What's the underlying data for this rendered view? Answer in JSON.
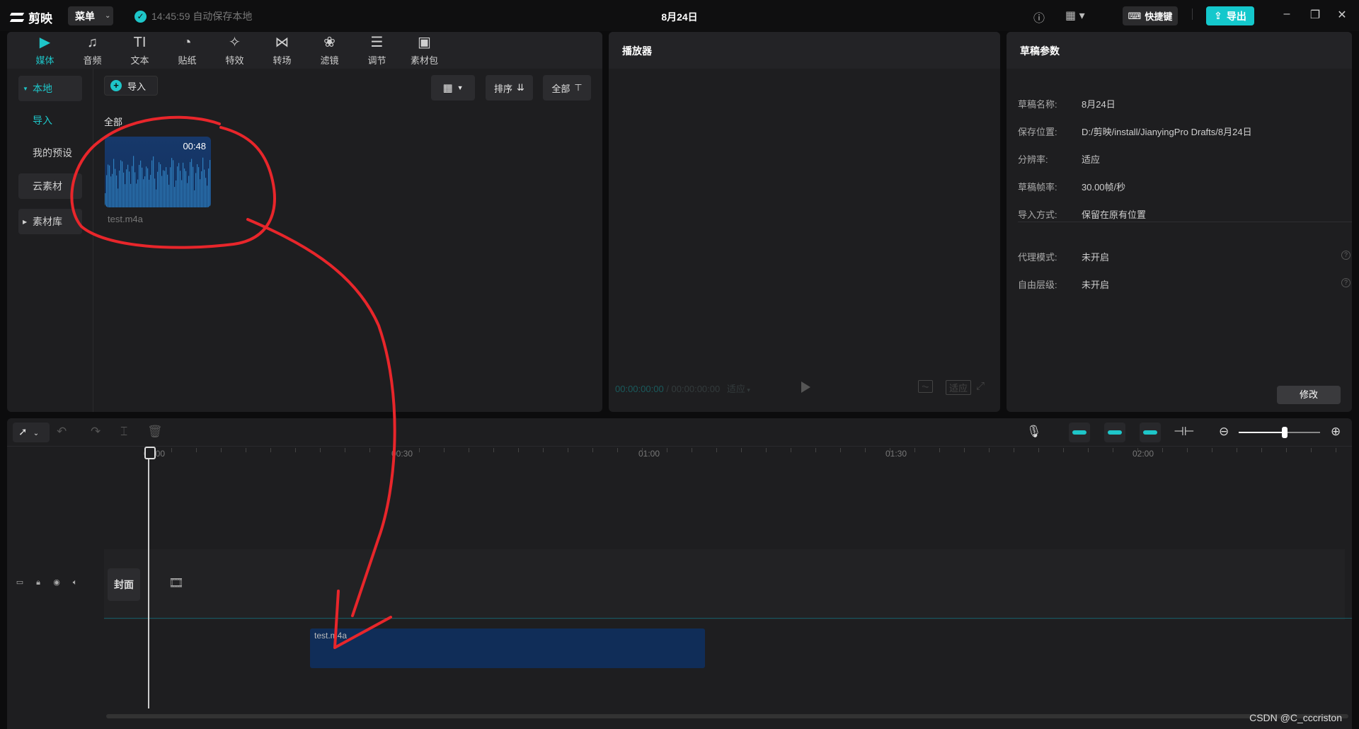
{
  "titlebar": {
    "app_name": "剪映",
    "menu_label": "菜单",
    "autosave_text": "14:45:59 自动保存本地",
    "project_title": "8月24日",
    "shortcut_label": "快捷键",
    "export_label": "导出"
  },
  "media": {
    "tools": [
      {
        "label": "媒体",
        "icon": "media-icon",
        "glyph": "▶"
      },
      {
        "label": "音频",
        "icon": "audio-icon",
        "glyph": "♫"
      },
      {
        "label": "文本",
        "icon": "text-icon",
        "glyph": "TI"
      },
      {
        "label": "贴纸",
        "icon": "sticker-icon",
        "glyph": "◔"
      },
      {
        "label": "特效",
        "icon": "effects-icon",
        "glyph": "✧"
      },
      {
        "label": "转场",
        "icon": "transition-icon",
        "glyph": "⋈"
      },
      {
        "label": "滤镜",
        "icon": "filter-icon",
        "glyph": "❀"
      },
      {
        "label": "调节",
        "icon": "adjust-icon",
        "glyph": "☰"
      },
      {
        "label": "素材包",
        "icon": "package-icon",
        "glyph": "▣"
      }
    ],
    "side": {
      "local": "本地",
      "import": "导入",
      "presets": "我的预设",
      "cloud": "云素材",
      "library": "素材库"
    },
    "import_label": "导入",
    "sort_label": "排序",
    "filter_label": "全部",
    "all_label": "全部",
    "clip_duration": "00:48",
    "clip_name": "test.m4a"
  },
  "player": {
    "title": "播放器",
    "current_time": "00:00:00:00",
    "total_time": "00:00:00:00",
    "ratio_label": "适应",
    "fit_label": "适应"
  },
  "draft": {
    "title": "草稿参数",
    "rows": [
      {
        "k": "草稿名称:",
        "v": "8月24日"
      },
      {
        "k": "保存位置:",
        "v": "D:/剪映/install/JianyingPro Drafts/8月24日"
      },
      {
        "k": "分辨率:",
        "v": "适应"
      },
      {
        "k": "草稿帧率:",
        "v": "30.00帧/秒"
      },
      {
        "k": "导入方式:",
        "v": "保留在原有位置"
      },
      {
        "k": "代理模式:",
        "v": "未开启"
      },
      {
        "k": "自由层级:",
        "v": "未开启"
      }
    ],
    "modify_label": "修改"
  },
  "timeline": {
    "ruler_labels": [
      "00:00",
      "00:30",
      "01:00",
      "01:30",
      "02:00"
    ],
    "cover_label": "封面",
    "clip_label": "test.m4a"
  },
  "watermark": "CSDN @C_cccriston",
  "colors": {
    "accent": "#1ec6c9",
    "clip": "#102d58",
    "annotation": "#e8262b"
  }
}
